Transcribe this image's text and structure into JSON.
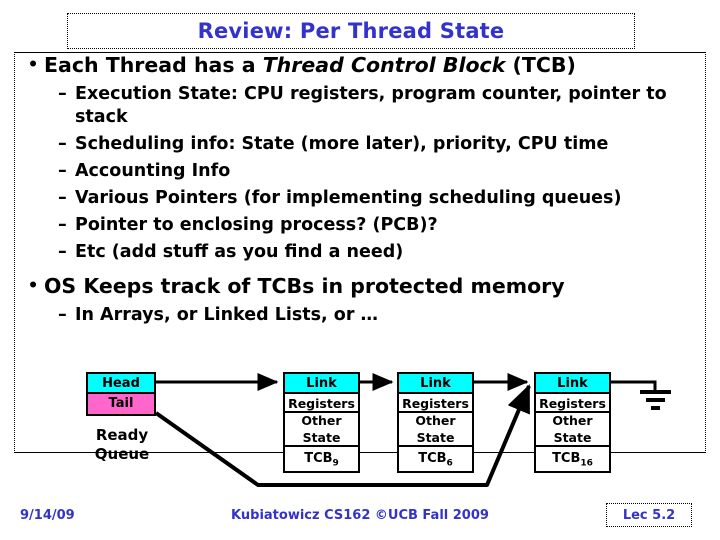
{
  "slide": {
    "title": "Review: Per Thread State",
    "title_color": "#3333cc"
  },
  "bullets": [
    {
      "level": 1,
      "marker": "•",
      "parts": [
        {
          "text": "Each Thread has a ",
          "italic": false
        },
        {
          "text": "Thread Control Block",
          "italic": true
        },
        {
          "text": " (TCB)",
          "italic": false
        }
      ]
    },
    {
      "level": 2,
      "marker": "–",
      "text": "Execution State: CPU registers, program counter, pointer to stack"
    },
    {
      "level": 2,
      "marker": "–",
      "text": "Scheduling info: State (more later), priority, CPU time"
    },
    {
      "level": 2,
      "marker": "–",
      "text": "Accounting Info"
    },
    {
      "level": 2,
      "marker": "–",
      "text": "Various Pointers (for implementing scheduling queues)"
    },
    {
      "level": 2,
      "marker": "–",
      "text": "Pointer to enclosing process? (PCB)?"
    },
    {
      "level": 2,
      "marker": "–",
      "text": "Etc (add stuff as you find a need)"
    },
    {
      "level": 1,
      "marker": "•",
      "parts": [
        {
          "text": "OS Keeps track of TCBs in protected memory",
          "italic": false
        }
      ]
    },
    {
      "level": 2,
      "marker": "–",
      "text": "In Arrays, or Linked Lists, or …"
    }
  ],
  "diagram": {
    "queue_head": {
      "head_label": "Head",
      "tail_label": "Tail",
      "head_color": "#00ffff",
      "tail_color": "#ff66cc"
    },
    "queue_caption_line1": "Ready",
    "queue_caption_line2": "Queue",
    "link_label": "Link",
    "registers_label": "Registers",
    "other_label": "Other",
    "state_label": "State",
    "nodes": [
      {
        "tcb_prefix": "TCB",
        "tcb_sub": "9"
      },
      {
        "tcb_prefix": "TCB",
        "tcb_sub": "6"
      },
      {
        "tcb_prefix": "TCB",
        "tcb_sub": "16"
      }
    ],
    "terminator": "ground-symbol"
  },
  "footer": {
    "date": "9/14/09",
    "center": "Kubiatowicz CS162 ©UCB Fall 2009",
    "lecture": "Lec 5.2",
    "color": "#3333cc"
  }
}
